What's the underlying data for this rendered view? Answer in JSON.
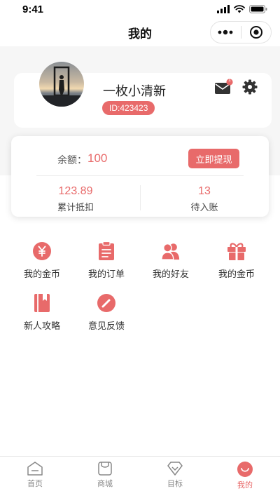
{
  "status_bar": {
    "time": "9:41"
  },
  "nav": {
    "title": "我的"
  },
  "profile": {
    "username": "一枚小清新",
    "id_text": "ID:423423",
    "unread_badge": "1"
  },
  "balance": {
    "label": "余额：",
    "value": "100",
    "withdraw_label": "立即提现",
    "stats": [
      {
        "value": "123.89",
        "label": "累计抵扣"
      },
      {
        "value": "13",
        "label": "待入账"
      }
    ]
  },
  "menu": [
    {
      "label": "我的金币",
      "icon": "yen-coin-icon"
    },
    {
      "label": "我的订单",
      "icon": "clipboard-icon"
    },
    {
      "label": "我的好友",
      "icon": "friends-icon"
    },
    {
      "label": "我的金币",
      "icon": "gift-icon"
    },
    {
      "label": "新人攻略",
      "icon": "book-icon"
    },
    {
      "label": "意见反馈",
      "icon": "pencil-icon"
    }
  ],
  "tabbar": [
    {
      "label": "首页",
      "icon": "home-icon"
    },
    {
      "label": "商城",
      "icon": "mall-icon"
    },
    {
      "label": "目标",
      "icon": "target-diamond-icon"
    },
    {
      "label": "我的",
      "icon": "me-smile-icon",
      "active": true
    }
  ],
  "colors": {
    "accent": "#e86a6a",
    "band": "#f6f6f6"
  }
}
